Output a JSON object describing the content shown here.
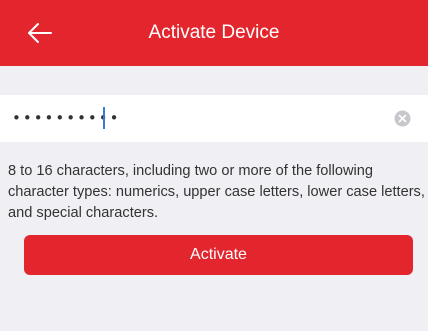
{
  "header": {
    "title": "Activate Device",
    "back_icon": "arrow-left-icon",
    "background": "#e3262e"
  },
  "password_field": {
    "value": "••••••••••",
    "clear_icon": "clear-circle-icon"
  },
  "hint": {
    "text": "8 to 16 characters, including two or more of the following character types: numerics, upper case letters, lower case letters, and special characters."
  },
  "actions": {
    "activate_label": "Activate",
    "accent": "#e3262e"
  }
}
